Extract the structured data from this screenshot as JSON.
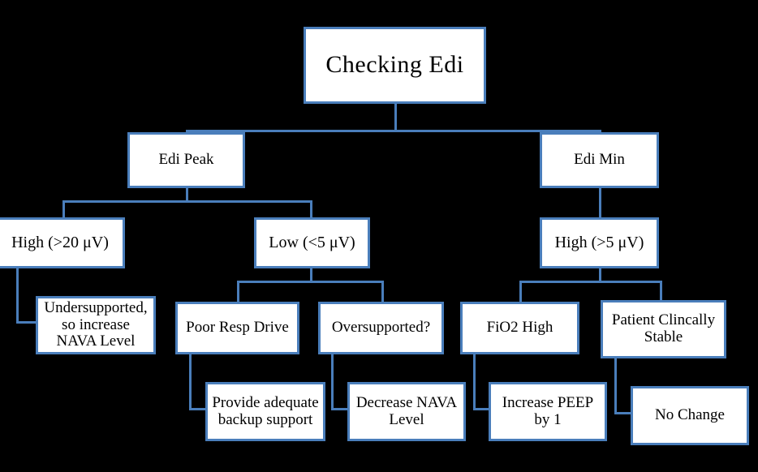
{
  "diagram": {
    "title": "Checking Edi",
    "background_color": "#000000",
    "box_fill_color": "#FFFFFF",
    "box_border_color": "#4A7EBB",
    "connector_color": "#4A7EBB",
    "text_color": "#000000"
  },
  "nodes": {
    "root": "Checking Edi",
    "edi_peak": "Edi Peak",
    "edi_min": "Edi Min",
    "peak_high": "High (>20 μV)",
    "peak_low": "Low (<5 μV)",
    "min_high": "High (>5 μV)",
    "undersupported": "Undersupported,\nso increase\nNAVA Level",
    "poor_resp_drive": "Poor Resp Drive",
    "oversupported": "Oversupported?",
    "fio2_high": "FiO2 High",
    "patient_stable": "Patient Clincally\nStable",
    "provide_backup": "Provide adequate\nbackup support",
    "decrease_nava": "Decrease NAVA\nLevel",
    "increase_peep": "Increase  PEEP\nby 1",
    "no_change": "No Change"
  },
  "chart_data": {
    "type": "diagram",
    "title": "Checking Edi",
    "layout": "top-down decision tree",
    "levels": [
      [
        "Checking Edi"
      ],
      [
        "Edi Peak",
        "Edi Min"
      ],
      [
        "High (>20 μV)",
        "Low (<5 μV)",
        "High (>5 μV)"
      ],
      [
        "Undersupported, so increase NAVA Level",
        "Poor Resp Drive",
        "Oversupported?",
        "FiO2 High",
        "Patient Clincally Stable"
      ],
      [
        "Provide adequate backup support",
        "Decrease NAVA Level",
        "Increase PEEP by 1",
        "No Change"
      ]
    ],
    "edges": [
      {
        "from": "Checking Edi",
        "to": "Edi Peak"
      },
      {
        "from": "Checking Edi",
        "to": "Edi Min"
      },
      {
        "from": "Edi Peak",
        "to": "High (>20 μV)"
      },
      {
        "from": "Edi Peak",
        "to": "Low (<5 μV)"
      },
      {
        "from": "Edi Min",
        "to": "High (>5 μV)"
      },
      {
        "from": "High (>20 μV)",
        "to": "Undersupported, so increase NAVA Level"
      },
      {
        "from": "Low (<5 μV)",
        "to": "Poor Resp Drive"
      },
      {
        "from": "Low (<5 μV)",
        "to": "Oversupported?"
      },
      {
        "from": "High (>5 μV)",
        "to": "FiO2 High"
      },
      {
        "from": "High (>5 μV)",
        "to": "Patient Clincally Stable"
      },
      {
        "from": "Poor Resp Drive",
        "to": "Provide adequate backup support"
      },
      {
        "from": "Oversupported?",
        "to": "Decrease NAVA Level"
      },
      {
        "from": "FiO2 High",
        "to": "Increase PEEP by 1"
      },
      {
        "from": "Patient Clincally Stable",
        "to": "No Change"
      }
    ]
  }
}
